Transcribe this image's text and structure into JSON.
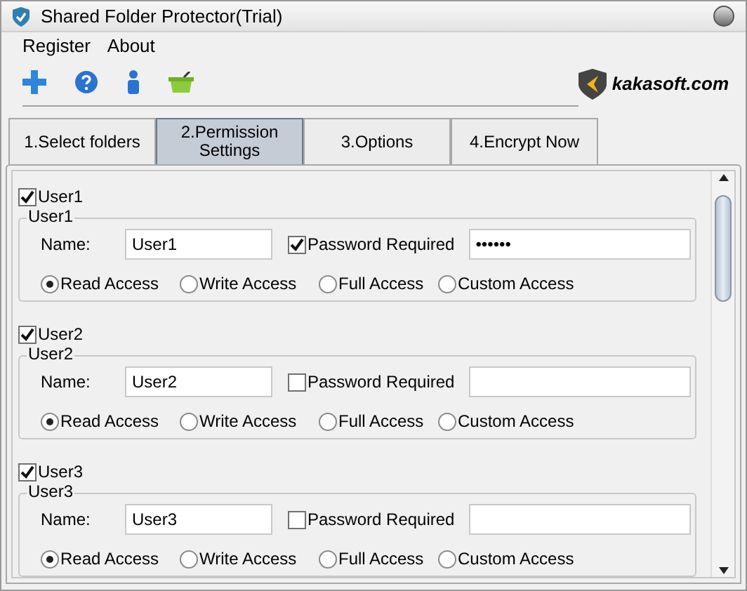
{
  "window": {
    "title": "Shared Folder Protector(Trial)"
  },
  "menu": [
    "Register",
    "About"
  ],
  "brand": {
    "text": "kakasoft.com"
  },
  "tabs": [
    {
      "label": "1.Select folders",
      "selected": false
    },
    {
      "label": "2.Permission Settings",
      "selected": true
    },
    {
      "label": "3.Options",
      "selected": false
    },
    {
      "label": "4.Encrypt Now",
      "selected": false
    }
  ],
  "users": [
    {
      "label": "User1",
      "checked": true,
      "group": "User1",
      "name_label": "Name:",
      "name": "User1",
      "password_required": {
        "label": "Password Required",
        "checked": true
      },
      "password": "••••••",
      "access": [
        {
          "label": "Read Access",
          "selected": true
        },
        {
          "label": "Write Access",
          "selected": false
        },
        {
          "label": "Full Access",
          "selected": false
        },
        {
          "label": "Custom Access",
          "selected": false
        }
      ]
    },
    {
      "label": "User2",
      "checked": true,
      "group": "User2",
      "name_label": "Name:",
      "name": "User2",
      "password_required": {
        "label": "Password Required",
        "checked": false
      },
      "access": [
        {
          "label": "Read Access",
          "selected": true
        },
        {
          "label": "Write Access",
          "selected": false
        },
        {
          "label": "Full Access",
          "selected": false
        },
        {
          "label": "Custom Access",
          "selected": false
        }
      ]
    },
    {
      "label": "User3",
      "checked": true,
      "group": "User3",
      "name_label": "Name:",
      "name": "User3",
      "password_required": {
        "label": "Password Required",
        "checked": false
      },
      "access": [
        {
          "label": "Read Access",
          "selected": true
        },
        {
          "label": "Write Access",
          "selected": false
        },
        {
          "label": "Full Access",
          "selected": false
        },
        {
          "label": "Custom Access",
          "selected": false
        }
      ]
    }
  ]
}
